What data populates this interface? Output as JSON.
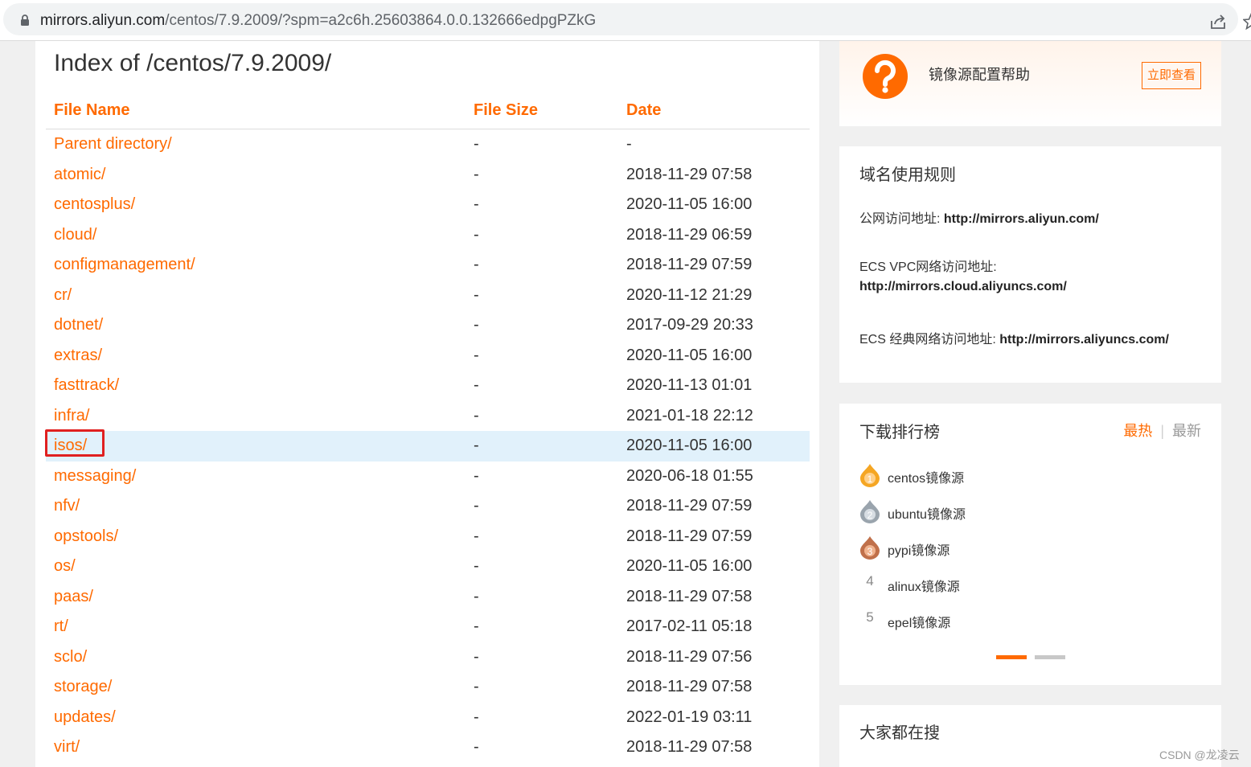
{
  "browser": {
    "url_host": "mirrors.aliyun.com",
    "url_path": "/centos/7.9.2009/?spm=a2c6h.25603864.0.0.132666edpgPZkG",
    "icons": [
      "lock-icon",
      "share-icon",
      "star-icon"
    ]
  },
  "listing": {
    "title": "Index of /centos/7.9.2009/",
    "headers": {
      "name": "File Name",
      "size": "File Size",
      "date": "Date"
    },
    "rows": [
      {
        "name": "Parent directory/",
        "size": "-",
        "date": "-"
      },
      {
        "name": "atomic/",
        "size": "-",
        "date": "2018-11-29 07:58"
      },
      {
        "name": "centosplus/",
        "size": "-",
        "date": "2020-11-05 16:00"
      },
      {
        "name": "cloud/",
        "size": "-",
        "date": "2018-11-29 06:59"
      },
      {
        "name": "configmanagement/",
        "size": "-",
        "date": "2018-11-29 07:59"
      },
      {
        "name": "cr/",
        "size": "-",
        "date": "2020-11-12 21:29"
      },
      {
        "name": "dotnet/",
        "size": "-",
        "date": "2017-09-29 20:33"
      },
      {
        "name": "extras/",
        "size": "-",
        "date": "2020-11-05 16:00"
      },
      {
        "name": "fasttrack/",
        "size": "-",
        "date": "2020-11-13 01:01"
      },
      {
        "name": "infra/",
        "size": "-",
        "date": "2021-01-18 22:12"
      },
      {
        "name": "isos/",
        "size": "-",
        "date": "2020-11-05 16:00"
      },
      {
        "name": "messaging/",
        "size": "-",
        "date": "2020-06-18 01:55"
      },
      {
        "name": "nfv/",
        "size": "-",
        "date": "2018-11-29 07:59"
      },
      {
        "name": "opstools/",
        "size": "-",
        "date": "2018-11-29 07:59"
      },
      {
        "name": "os/",
        "size": "-",
        "date": "2020-11-05 16:00"
      },
      {
        "name": "paas/",
        "size": "-",
        "date": "2018-11-29 07:58"
      },
      {
        "name": "rt/",
        "size": "-",
        "date": "2017-02-11 05:18"
      },
      {
        "name": "sclo/",
        "size": "-",
        "date": "2018-11-29 07:56"
      },
      {
        "name": "storage/",
        "size": "-",
        "date": "2018-11-29 07:58"
      },
      {
        "name": "updates/",
        "size": "-",
        "date": "2022-01-19 03:11"
      },
      {
        "name": "virt/",
        "size": "-",
        "date": "2018-11-29 07:58"
      }
    ],
    "highlighted_row": "isos/"
  },
  "sidebar": {
    "help": {
      "title": "镜像源配置帮助",
      "button": "立即查看",
      "icon": "question-icon"
    },
    "rules": {
      "title": "域名使用规则",
      "public_label": "公网访问地址:",
      "public_url": "http://mirrors.aliyun.com/",
      "vpc_label": "ECS VPC网络访问地址:",
      "vpc_url": "http://mirrors.cloud.aliyuncs.com/",
      "classic_label": "ECS 经典网络访问地址:",
      "classic_url": "http://mirrors.aliyuncs.com/"
    },
    "ranking": {
      "title": "下载排行榜",
      "tab_hot": "最热",
      "tab_sep": "|",
      "tab_new": "最新",
      "items": [
        {
          "rank": "1",
          "label": "centos镜像源"
        },
        {
          "rank": "2",
          "label": "ubuntu镜像源"
        },
        {
          "rank": "3",
          "label": "pypi镜像源"
        },
        {
          "rank": "4",
          "label": "alinux镜像源"
        },
        {
          "rank": "5",
          "label": "epel镜像源"
        }
      ]
    },
    "search": {
      "title": "大家都在搜"
    }
  },
  "watermark": "CSDN @龙凌云",
  "colors": {
    "accent": "#ff6a00",
    "highlight_row": "#e1f1fb",
    "annotation_box": "#e02020"
  }
}
